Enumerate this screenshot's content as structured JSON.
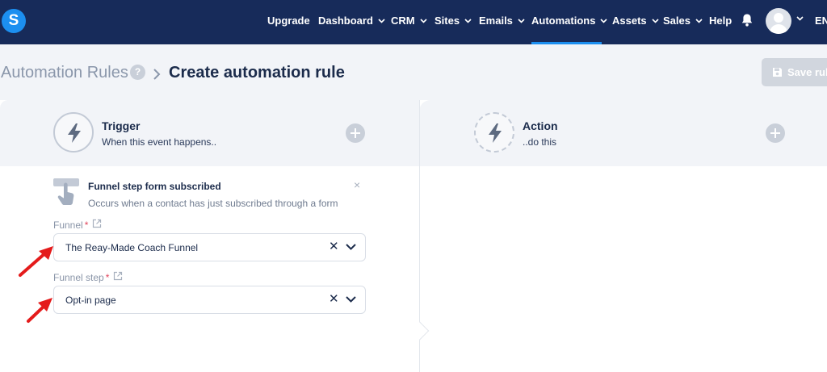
{
  "app": {
    "logo_letter": "S",
    "accent_color": "#1c8ff0",
    "nav_bg_color": "#172b5a"
  },
  "nav": {
    "items": [
      {
        "label": "Upgrade",
        "has_dropdown": false
      },
      {
        "label": "Dashboard",
        "has_dropdown": true
      },
      {
        "label": "CRM",
        "has_dropdown": true
      },
      {
        "label": "Sites",
        "has_dropdown": true
      },
      {
        "label": "Emails",
        "has_dropdown": true
      },
      {
        "label": "Automations",
        "has_dropdown": true,
        "active": true
      },
      {
        "label": "Assets",
        "has_dropdown": true
      },
      {
        "label": "Sales",
        "has_dropdown": true
      },
      {
        "label": "Help",
        "has_dropdown": false
      }
    ],
    "notifications_icon": "bell-icon",
    "language": "EN"
  },
  "breadcrumb": {
    "root": "Automation Rules",
    "help": "?",
    "separator": ">",
    "current": "Create automation rule"
  },
  "toolbar": {
    "save_label": "Save rule",
    "save_icon": "floppy-disk-icon"
  },
  "trigger": {
    "title": "Trigger",
    "subtitle": "When this event happens..",
    "icon": "lightning-icon"
  },
  "action": {
    "title": "Action",
    "subtitle": "..do this",
    "icon": "lightning-cycle-icon"
  },
  "trigger_card": {
    "title": "Funnel step form subscribed",
    "description": "Occurs when a contact has just subscribed through a form",
    "icon": "hand-pointer-icon",
    "close": "×"
  },
  "fields": {
    "funnel": {
      "label": "Funnel",
      "required_mark": "*",
      "value": "The Reay-Made Coach Funnel"
    },
    "funnel_step": {
      "label": "Funnel step",
      "required_mark": "*",
      "value": "Opt-in page"
    }
  },
  "annotation_color": "#e41b1b"
}
